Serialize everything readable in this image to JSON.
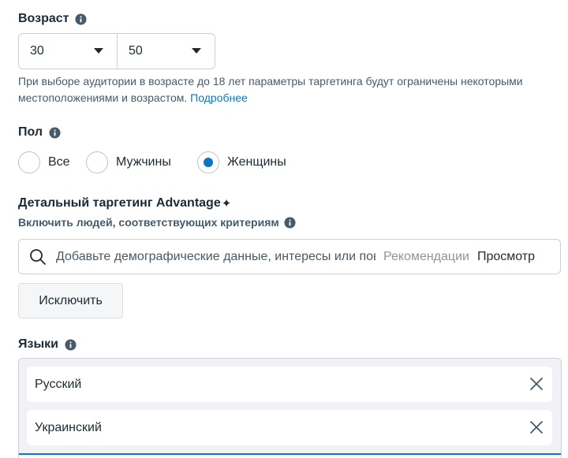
{
  "age": {
    "title": "Возраст",
    "min_value": "30",
    "max_value": "50",
    "note": "При выборе аудитории в возрасте до 18 лет параметры таргетинга будут ограничены некоторыми местоположениями и возрастом.",
    "note_link": "Подробнее"
  },
  "gender": {
    "title": "Пол",
    "options": [
      {
        "label": "Все",
        "checked": false
      },
      {
        "label": "Мужчины",
        "checked": false
      },
      {
        "label": "Женщины",
        "checked": true
      }
    ]
  },
  "detailed_targeting": {
    "title": "Детальный таргетинг Advantage",
    "title_mark": "✦",
    "subtitle": "Включить людей, соответствующих критериям",
    "search_placeholder": "Добавьте демографические данные, интересы или поведение",
    "recommendations_label": "Рекомендации",
    "browse_label": "Просмотр",
    "exclude_label": "Исключить"
  },
  "languages": {
    "title": "Языки",
    "items": [
      "Русский",
      "Украинский"
    ]
  },
  "colors": {
    "accent": "#0a78be",
    "text": "#1c2b33",
    "muted": "#465a69"
  }
}
